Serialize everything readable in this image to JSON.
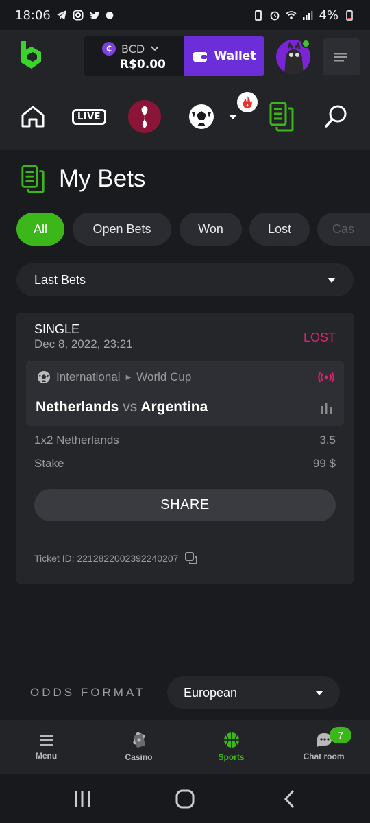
{
  "status_bar": {
    "time": "18:06",
    "battery": "4%"
  },
  "header": {
    "currency": "BCD",
    "balance": "R$0.00",
    "wallet_label": "Wallet"
  },
  "nav": {
    "live_label": "LIVE"
  },
  "page": {
    "title": "My Bets"
  },
  "filters": [
    "All",
    "Open Bets",
    "Won",
    "Lost",
    "Cas"
  ],
  "bets_dropdown": {
    "selected": "Last Bets"
  },
  "bet": {
    "type": "SINGLE",
    "date": "Dec 8, 2022, 23:21",
    "status": "LOST",
    "league": "International",
    "tournament": "World Cup",
    "home": "Netherlands",
    "vs": "vs",
    "away": "Argentina",
    "selection_label": "1x2 Netherlands",
    "selection_odds": "3.5",
    "stake_label": "Stake",
    "stake_value": "99 $",
    "share_label": "SHARE",
    "ticket": "Ticket ID: 2212822002392240207"
  },
  "odds_format": {
    "label": "ODDS FORMAT",
    "selected": "European"
  },
  "bottom_nav": {
    "menu": "Menu",
    "casino": "Casino",
    "sports": "Sports",
    "chat": "Chat room",
    "chat_count": "7"
  },
  "colors": {
    "accent": "#3bb71a",
    "wallet": "#6b2ed8",
    "lost": "#e0206f",
    "background": "#1a1b1e"
  }
}
